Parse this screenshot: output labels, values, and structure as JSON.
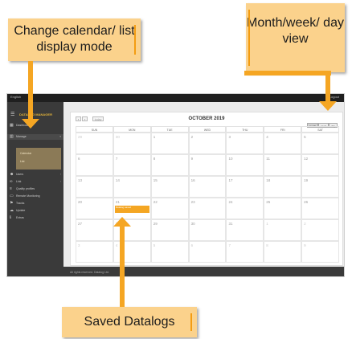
{
  "callouts": {
    "mode": "Change calendar/ list display mode",
    "view": "Month/week/ day view",
    "datalogs": "Saved Datalogs"
  },
  "app": {
    "top_left": "English",
    "top_right": "Logout",
    "brand": "DATALOG MANAGER",
    "footer": "All rights reserved. Datalog Ltd."
  },
  "sidebar": {
    "items": [
      {
        "label": "Dashboard",
        "icon": "dashboard-icon"
      },
      {
        "label": "Manage",
        "icon": "chart-icon"
      },
      {
        "label": "Users",
        "icon": "users-icon"
      },
      {
        "label": "Link",
        "icon": "link-icon"
      },
      {
        "label": "Quality profiles",
        "icon": "list-icon"
      },
      {
        "label": "Remote Monitoring",
        "icon": "monitor-icon"
      },
      {
        "label": "Tracks",
        "icon": "track-icon"
      },
      {
        "label": "Update",
        "icon": "update-icon"
      },
      {
        "label": "Extras",
        "icon": "info-icon"
      }
    ],
    "submenu": [
      "Calendar",
      "List"
    ]
  },
  "calendar": {
    "title": "OCTOBER 2019",
    "prev": "‹",
    "next": "›",
    "today": "today",
    "views": [
      "month",
      "week",
      "day"
    ],
    "active_view": "month",
    "days_of_week": [
      "SUN",
      "MON",
      "TUE",
      "WED",
      "THU",
      "FRI",
      "SAT"
    ],
    "weeks": [
      [
        "29",
        "30",
        "1",
        "2",
        "3",
        "4",
        "5"
      ],
      [
        "6",
        "7",
        "8",
        "9",
        "10",
        "11",
        "12"
      ],
      [
        "13",
        "14",
        "15",
        "16",
        "17",
        "18",
        "19"
      ],
      [
        "20",
        "21",
        "22",
        "23",
        "24",
        "25",
        "26"
      ],
      [
        "27",
        "28",
        "29",
        "30",
        "31",
        "1",
        "2"
      ],
      [
        "3",
        "4",
        "5",
        "6",
        "7",
        "8",
        "9"
      ]
    ],
    "event_label": "Datalog saved",
    "event_day": "21"
  },
  "colors": {
    "accent": "#f5a623",
    "callout_bg": "#fbd28c"
  }
}
